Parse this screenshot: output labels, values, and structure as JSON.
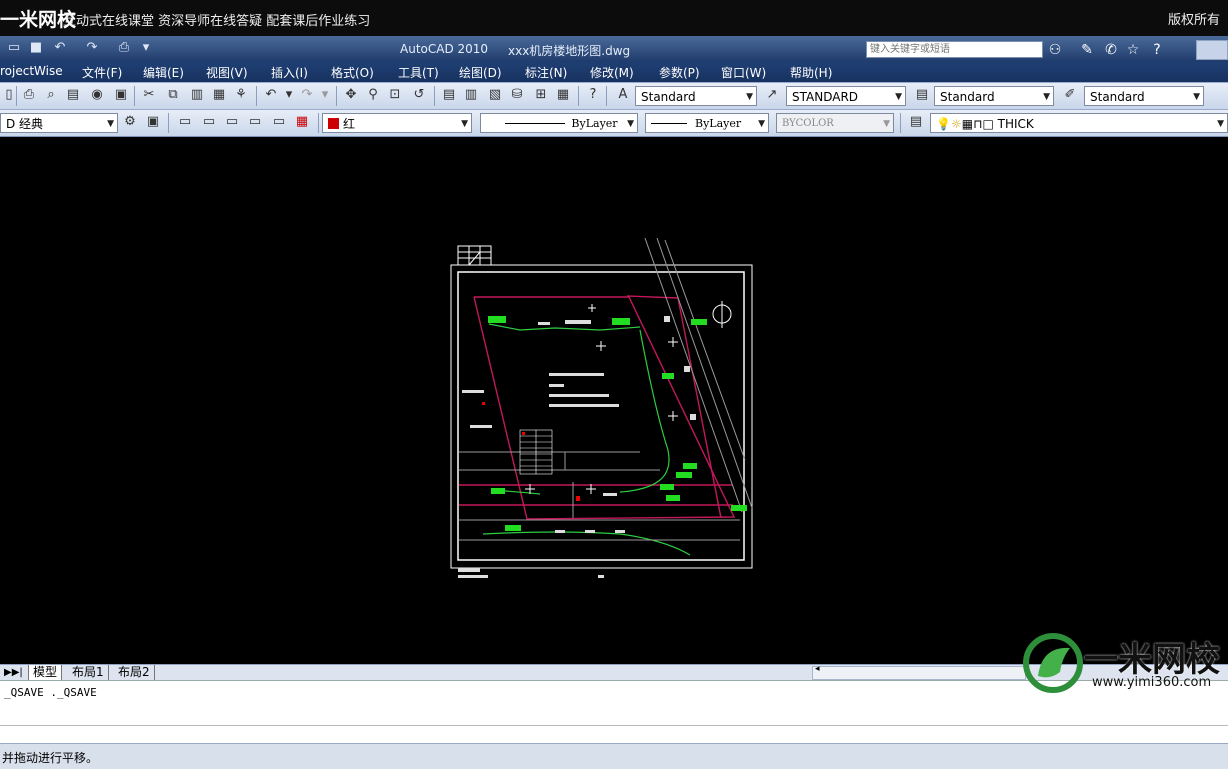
{
  "banner": {
    "brand": "一米网校",
    "slogan": "互动式在线课堂  资深导师在线答疑  配套课后作业练习",
    "copyright": "版权所有"
  },
  "titlebar": {
    "app": "AutoCAD 2010",
    "file": "xxx机房楼地形图.dwg",
    "search_placeholder": "键入关键字或短语"
  },
  "menu": [
    "rojectWise",
    "文件(F)",
    "编辑(E)",
    "视图(V)",
    "插入(I)",
    "格式(O)",
    "工具(T)",
    "绘图(D)",
    "标注(N)",
    "修改(M)",
    "参数(P)",
    "窗口(W)",
    "帮助(H)"
  ],
  "toolbar1": {
    "text_style": "Standard",
    "dim_style": "STANDARD",
    "table_style": "Standard",
    "multileader_style": "Standard"
  },
  "toolbar2": {
    "workspace": "D 经典",
    "color": "红",
    "linetype": "ByLayer",
    "lineweight": "ByLayer",
    "plotstyle": "BYCOLOR",
    "layer": "THICK"
  },
  "colors": {
    "accent_red": "#cc0000",
    "drawing_green": "#22dd22",
    "drawing_magenta": "#c2185b"
  },
  "tabs": [
    "模型",
    "布局1",
    "布局2"
  ],
  "command_history": "_QSAVE  ._QSAVE",
  "status_text": "并拖动进行平移。",
  "watermark": {
    "name": "一米网校",
    "url": "www.yimi360.com"
  }
}
